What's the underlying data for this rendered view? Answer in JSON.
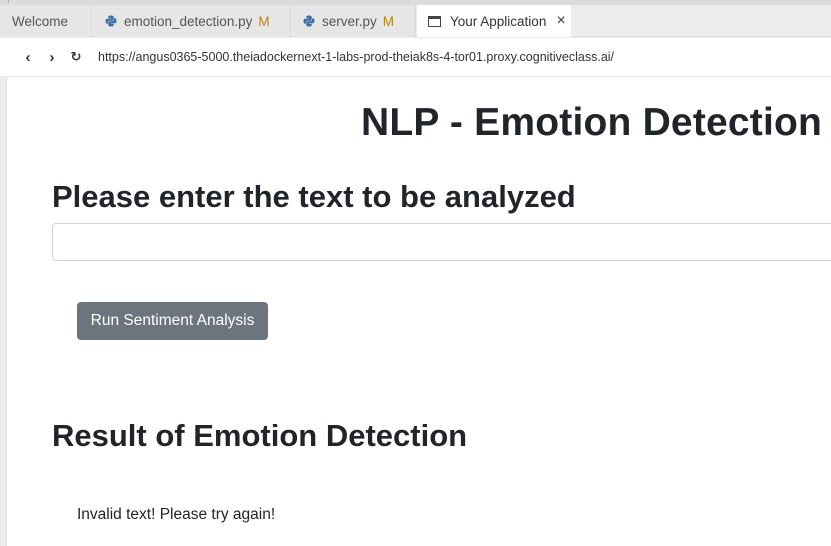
{
  "tabs": [
    {
      "label": "Welcome",
      "icon": "",
      "modified": ""
    },
    {
      "label": "emotion_detection.py",
      "icon": "python-file-icon",
      "modified": "M"
    },
    {
      "label": "server.py",
      "icon": "python-file-icon",
      "modified": "M"
    },
    {
      "label": "Your Application",
      "icon": "browser-window-icon",
      "modified": ""
    }
  ],
  "nav": {
    "back": "‹",
    "forward": "›",
    "reload": "↻",
    "url": "https://angus0365-5000.theiadockernext-1-labs-prod-theiak8s-4-tor01.proxy.cognitiveclass.ai/"
  },
  "page": {
    "title": "NLP - Emotion Detection",
    "prompt_heading": "Please enter the text to be analyzed",
    "input_value": "",
    "run_button": "Run Sentiment Analysis",
    "result_heading": "Result of Emotion Detection",
    "result_text": "Invalid text! Please try again!"
  },
  "colors": {
    "button_bg": "#6c757d",
    "modified": "#b8860b",
    "python_blue": "#3a6ea5",
    "python_yellow": "#f2c94c"
  }
}
